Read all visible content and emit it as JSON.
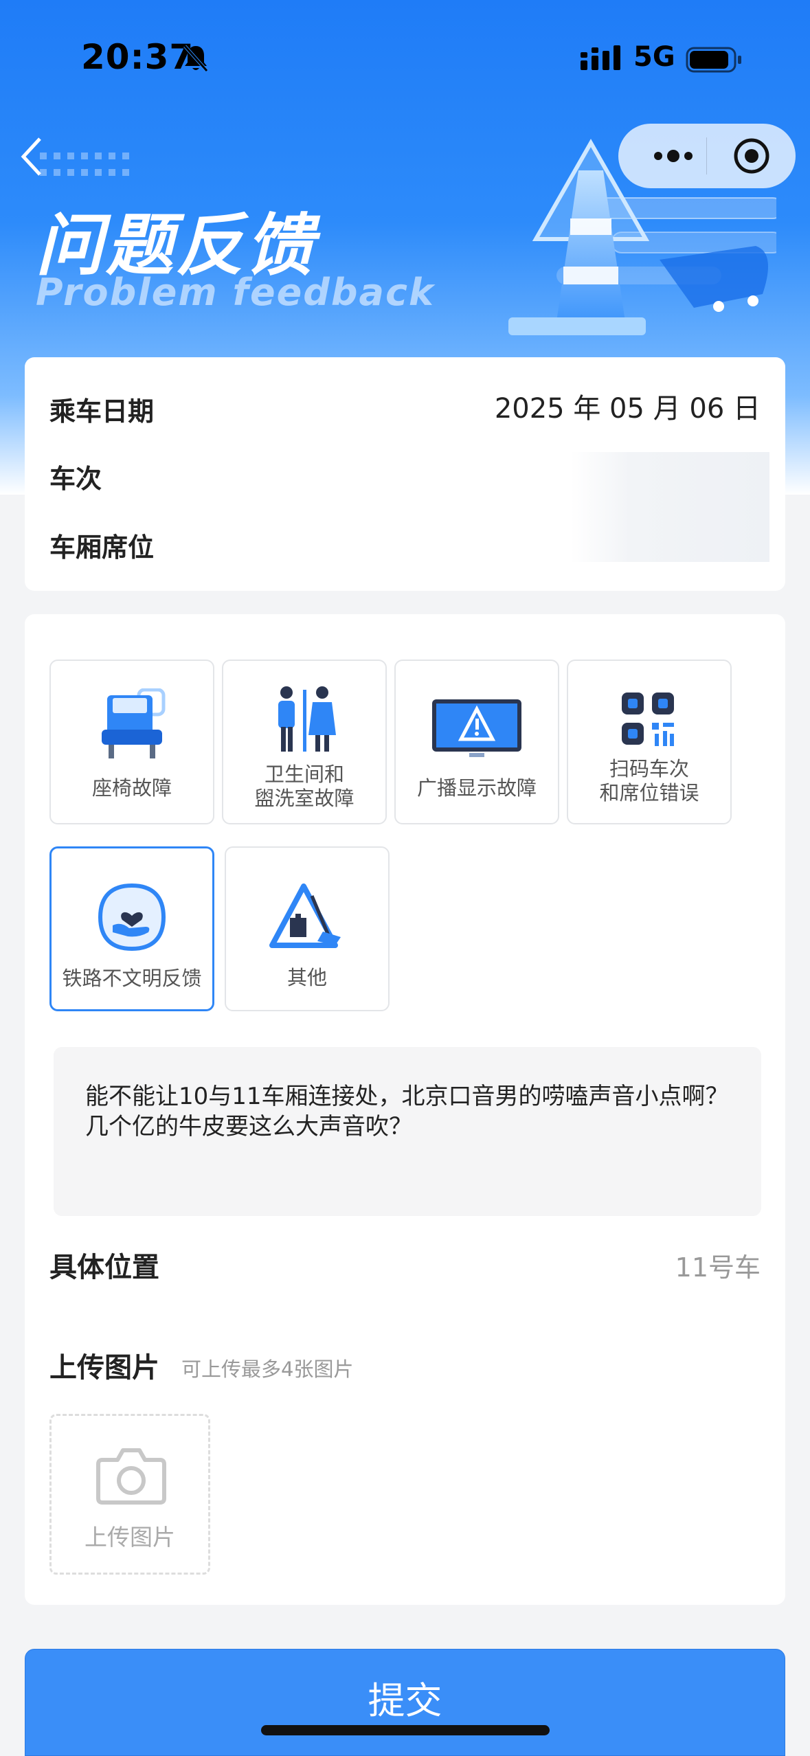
{
  "status_bar": {
    "time": "20:37",
    "network": "5G"
  },
  "header": {
    "title_zh": "问题反馈",
    "title_en": "Problem feedback"
  },
  "trip": {
    "date_label": "乘车日期",
    "date_value": "2025 年 05 月 06 日",
    "train_label": "车次",
    "seat_label": "车厢席位"
  },
  "categories": [
    {
      "label": "座椅故障",
      "icon": "seat-icon",
      "selected": false
    },
    {
      "label": "卫生间和\n盥洗室故障",
      "icon": "restroom-icon",
      "selected": false
    },
    {
      "label": "广播显示故障",
      "icon": "display-warning-icon",
      "selected": false
    },
    {
      "label": "扫码车次\n和席位错误",
      "icon": "qr-code-icon",
      "selected": false
    },
    {
      "label": "铁路不文明反馈",
      "icon": "heart-hand-icon",
      "selected": true
    },
    {
      "label": "其他",
      "icon": "warning-cleaning-icon",
      "selected": false
    }
  ],
  "feedback": {
    "text": "能不能让10与11车厢连接处，北京口音男的唠嗑声音小点啊？几个亿的牛皮要这么大声音吹？"
  },
  "location": {
    "label": "具体位置",
    "value": "11号车"
  },
  "upload": {
    "label": "上传图片",
    "hint": "可上传最多4张图片",
    "button_label": "上传图片"
  },
  "submit_label": "提交",
  "colors": {
    "accent": "#3a8ef8",
    "hero_top": "#1f7cf7",
    "selected_border": "#2f86f6"
  }
}
